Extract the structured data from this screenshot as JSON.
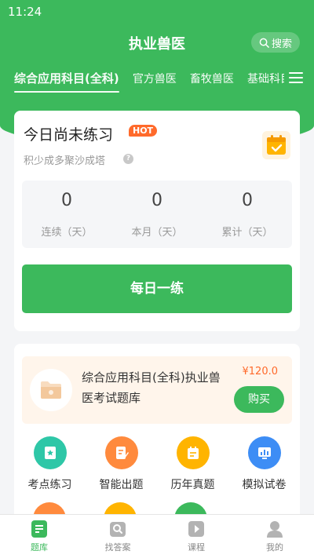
{
  "status_bar": {
    "time": "11:24"
  },
  "header": {
    "title": "执业兽医",
    "search_label": "搜索"
  },
  "tabs": [
    {
      "label": "综合应用科目(全科)",
      "active": true
    },
    {
      "label": "官方兽医",
      "active": false
    },
    {
      "label": "畜牧兽医",
      "active": false
    },
    {
      "label": "基础科目",
      "active": false
    }
  ],
  "practice_card": {
    "title": "今日尚未练习",
    "hot_badge": "HOT",
    "subtitle": "积少成多聚沙成塔",
    "stats": [
      {
        "value": "0",
        "label": "连续（天）"
      },
      {
        "value": "0",
        "label": "本月（天）"
      },
      {
        "value": "0",
        "label": "累计（天）"
      }
    ],
    "daily_button": "每日一练"
  },
  "product": {
    "name": "综合应用科目(全科)执业兽医考试题库",
    "price": "¥120.0",
    "buy_label": "购买"
  },
  "features": [
    {
      "label": "考点练习",
      "color": "#2ec7a7"
    },
    {
      "label": "智能出题",
      "color": "#ff8a3d"
    },
    {
      "label": "历年真题",
      "color": "#ffb400"
    },
    {
      "label": "模拟试卷",
      "color": "#3d8df5"
    }
  ],
  "bottom_nav": [
    {
      "label": "题库",
      "active": true
    },
    {
      "label": "找答案",
      "active": false
    },
    {
      "label": "课程",
      "active": false
    },
    {
      "label": "我的",
      "active": false
    }
  ],
  "colors": {
    "brand_green": "#3cb95c",
    "accent_orange": "#ff6a2b"
  }
}
